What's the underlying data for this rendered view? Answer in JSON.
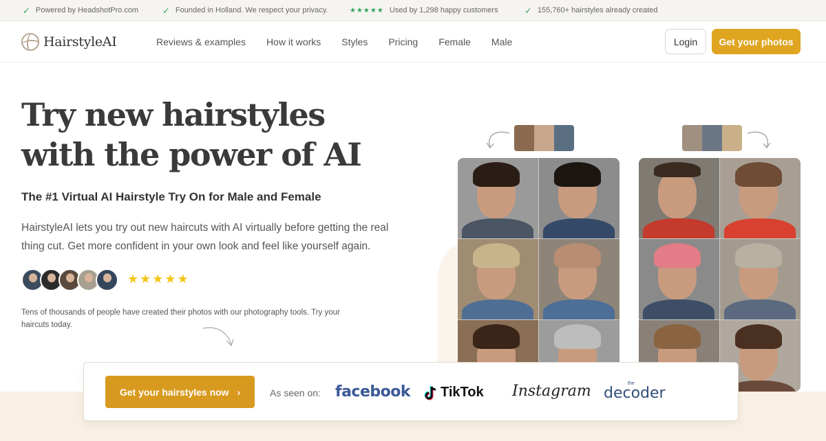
{
  "topbar": {
    "items": [
      "Powered by HeadshotPro.com",
      "Founded in Holland. We respect your privacy.",
      "Used by 1,298 happy customers",
      "155,760+ hairstyles already created"
    ],
    "stars": "★★★★★"
  },
  "nav": {
    "brand": "HairstyleAI",
    "links": [
      "Reviews & examples",
      "How it works",
      "Styles",
      "Pricing",
      "Female",
      "Male"
    ],
    "login_label": "Login",
    "cta_label": "Get your photos"
  },
  "hero": {
    "title_line1": "Try new hairstyles",
    "title_line2": "with the power of AI",
    "subtitle": "The #1 Virtual AI Hairstyle Try On for Male and Female",
    "description": "HairstyleAI lets you try out new haircuts with AI virtually before getting the real thing cut. Get more confident in your own look and feel like yourself again.",
    "rating_stars": "★★★★★",
    "rating_value": 5,
    "social_proof": "Tens of thousands of people have created their photos with our photography tools. Try your haircuts today."
  },
  "cta_bar": {
    "button_label": "Get your hairstyles now",
    "button_chevron": "›",
    "seen_on_label": "As seen on:",
    "press_logos": {
      "facebook": "facebook",
      "tiktok": "TikTok",
      "instagram": "Instagram",
      "decoder_small": "the",
      "decoder": "decoder"
    }
  },
  "colors": {
    "accent": "#e0a520",
    "cta": "#d89a1e",
    "check_green": "#39a35b",
    "star_yellow": "#f5c518",
    "facebook_blue": "#3b5998",
    "band": "#f9efe3"
  }
}
